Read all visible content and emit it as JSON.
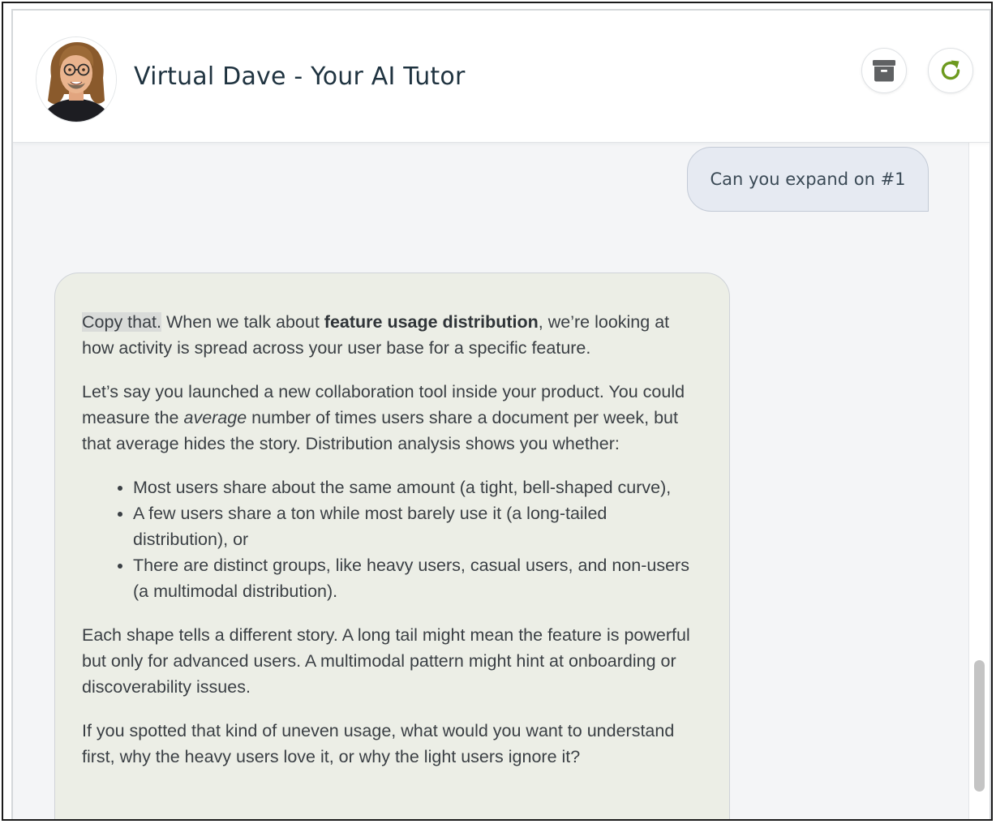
{
  "header": {
    "title": "Virtual Dave - Your AI Tutor",
    "avatar_icon": "tutor-avatar-photo",
    "archive_icon": "archive-icon",
    "refresh_icon": "refresh-icon",
    "archive_color": "#5f6163",
    "refresh_color": "#6d9a1e"
  },
  "conversation": {
    "user_message": "Can you expand on #1",
    "reply": {
      "p1_highlight": "Copy that.",
      "p1_before_bold": " When we talk about ",
      "p1_bold": "feature usage distribution",
      "p1_after_bold": ", we’re looking at how activity is spread across your user base for a specific feature.",
      "p2_before_italic": "Let’s say you launched a new collaboration tool inside your product. You could measure the ",
      "p2_italic": "average",
      "p2_after_italic": " number of times users share a document per week, but that average hides the story. Distribution analysis shows you whether:",
      "bullets": [
        "Most users share about the same amount (a tight, bell-shaped curve),",
        "A few users share a ton while most barely use it (a long-tailed distribution), or",
        "There are distinct groups, like heavy users, casual users, and non-users (a multimodal distribution)."
      ],
      "p3": "Each shape tells a different story. A long tail might mean the feature is powerful but only for advanced users. A multimodal pattern might hint at onboarding or discoverability issues.",
      "p4": "If you spotted that kind of uneven usage, what would you want to understand first, why the heavy users love it, or why the light users ignore it?"
    }
  },
  "colors": {
    "user_bubble_bg": "#e6eaf2",
    "bot_bubble_bg": "#eceee6",
    "title_color": "#1f3340"
  },
  "scrollbar": {
    "thumb_icon": "scrollbar-thumb"
  }
}
